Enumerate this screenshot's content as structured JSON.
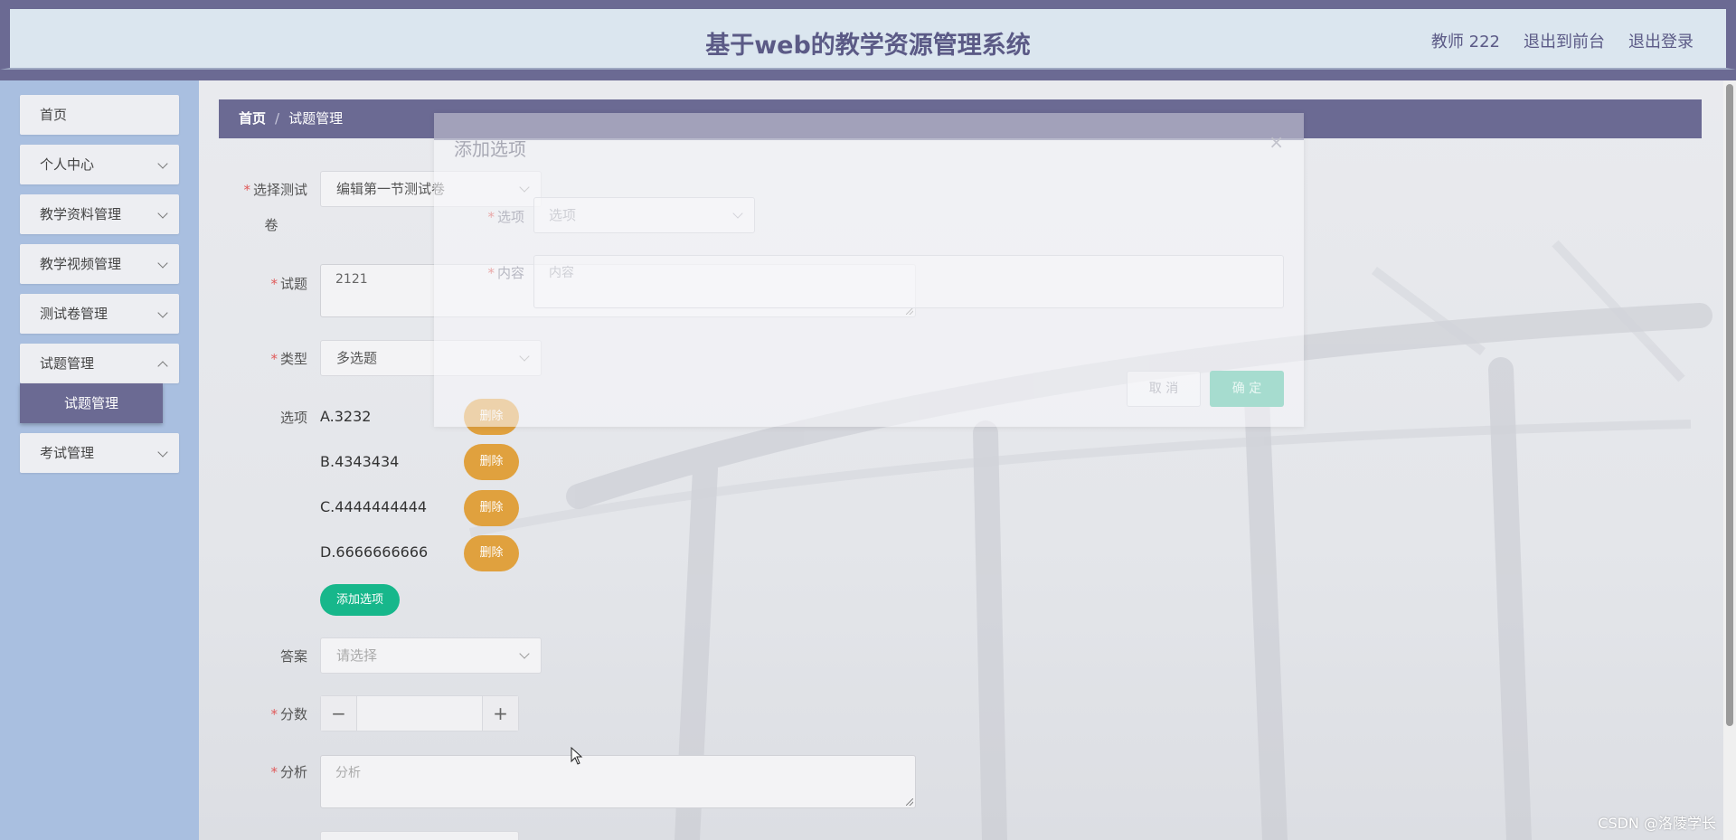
{
  "app": {
    "title": "基于web的教学资源管理系统",
    "user_label": "教师 222",
    "back_to_front": "退出到前台",
    "logout": "退出登录"
  },
  "sidebar": {
    "items": [
      {
        "label": "首页",
        "has_children": false
      },
      {
        "label": "个人中心",
        "has_children": true
      },
      {
        "label": "教学资料管理",
        "has_children": true
      },
      {
        "label": "教学视频管理",
        "has_children": true
      },
      {
        "label": "测试卷管理",
        "has_children": true
      },
      {
        "label": "试题管理",
        "has_children": true
      },
      {
        "label": "考试管理",
        "has_children": true
      }
    ],
    "active_submenu": "试题管理"
  },
  "breadcrumb": {
    "home": "首页",
    "separator": "/",
    "current": "试题管理"
  },
  "form": {
    "test_paper": {
      "label_line1": "选择测试",
      "label_line2": "卷",
      "value": "编辑第一节测试卷"
    },
    "question": {
      "label": "试题",
      "value": "2121"
    },
    "type": {
      "label": "类型",
      "value": "多选题"
    },
    "options": {
      "label": "选项",
      "items": [
        {
          "text": "A.3232",
          "delete_label": "删除"
        },
        {
          "text": "B.4343434",
          "delete_label": "删除"
        },
        {
          "text": "C.4444444444",
          "delete_label": "删除"
        },
        {
          "text": "D.6666666666",
          "delete_label": "删除"
        }
      ],
      "add_label": "添加选项"
    },
    "answer": {
      "label": "答案",
      "placeholder": "请选择"
    },
    "score": {
      "label": "分数",
      "minus": "−",
      "plus": "+",
      "value": ""
    },
    "analysis": {
      "label": "分析",
      "placeholder": "分析"
    },
    "required_mark": "*"
  },
  "dialog": {
    "title": "添加选项",
    "close": "×",
    "option_label": "选项",
    "option_placeholder": "选项",
    "content_label": "内容",
    "content_placeholder": "内容",
    "cancel_label": "取 消",
    "ok_label": "确 定"
  },
  "watermark": "CSDN @洛陵学长",
  "colors": {
    "brand": "#6b6a93",
    "sidebar_bg": "#a9bfe0",
    "delete_button": "#e0a13e",
    "add_button": "#17b78b",
    "required": "#e05a5a"
  }
}
